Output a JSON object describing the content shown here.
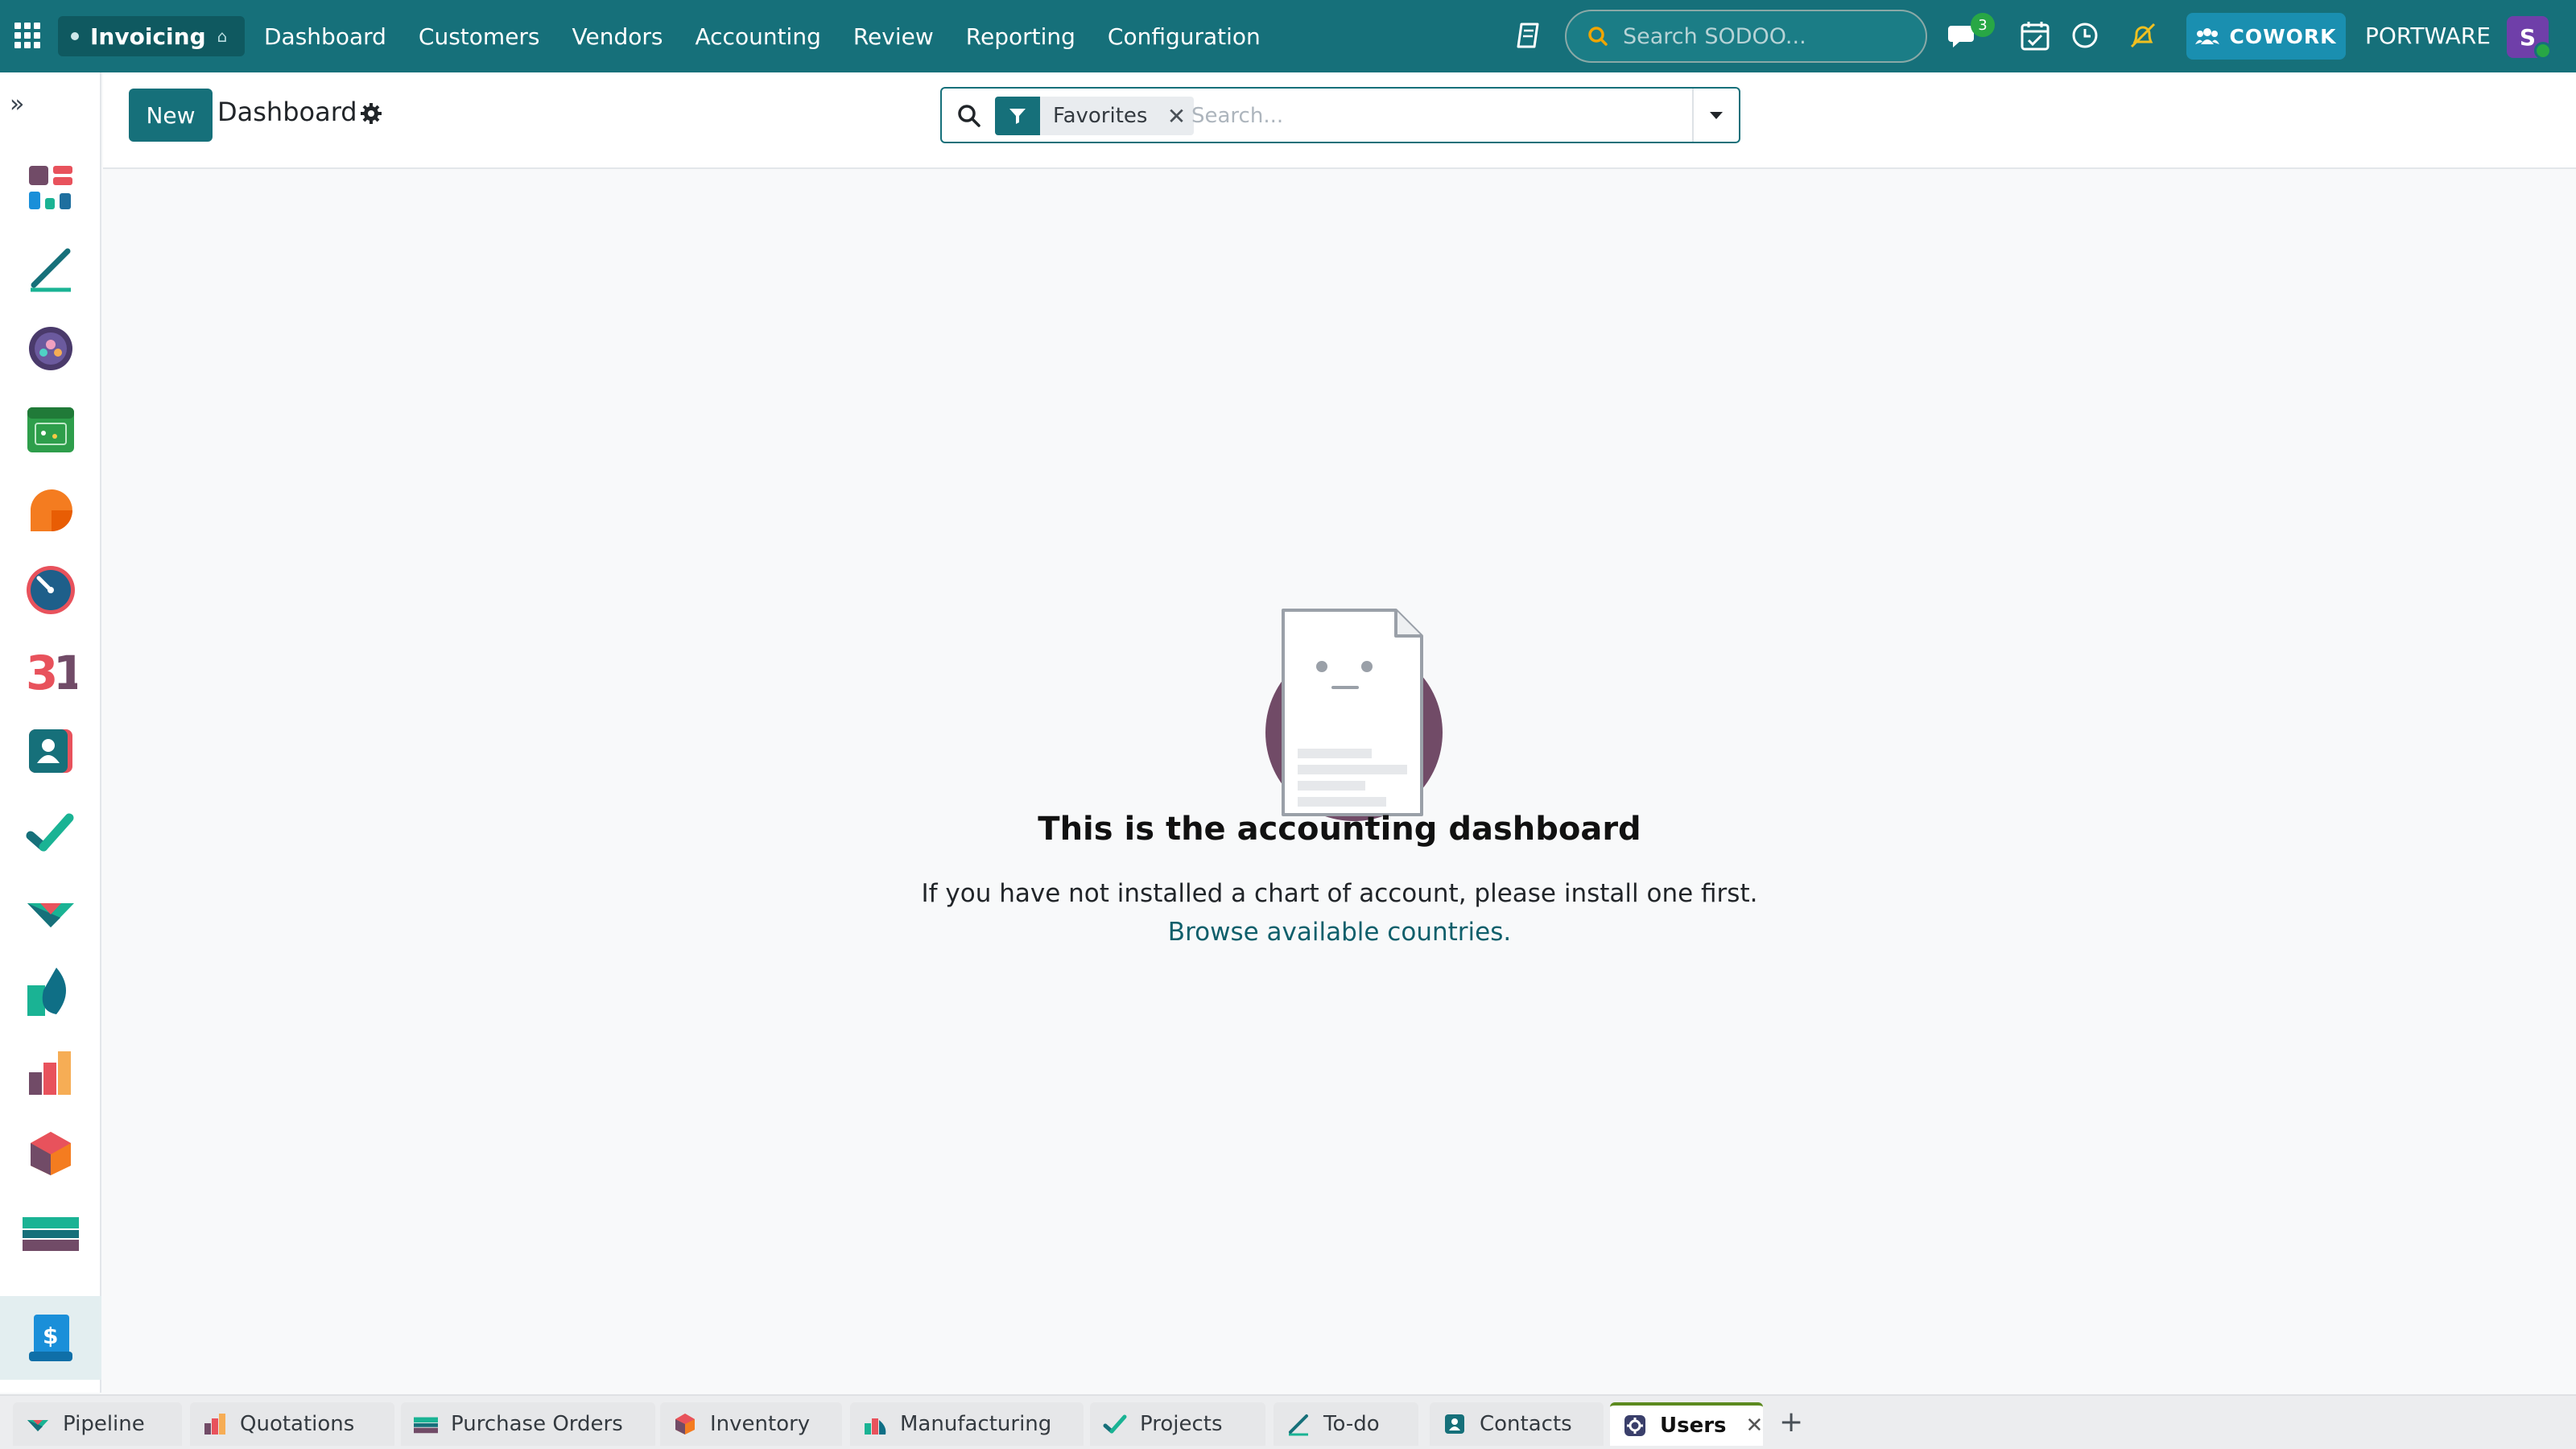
{
  "topbar": {
    "app_name": "Invoicing",
    "menu": [
      "Dashboard",
      "Customers",
      "Vendors",
      "Accounting",
      "Review",
      "Reporting",
      "Configuration"
    ],
    "search_placeholder": "Search SODOO...",
    "messages_count": "3",
    "cowork_label": "COWORK",
    "company": "PORTWARE",
    "avatar_initial": "S"
  },
  "sidebar": {
    "apps": [
      "dashboards-icon",
      "todo-icon",
      "discuss-icon",
      "calendar-icon",
      "helpdesk-icon",
      "timesheets-icon",
      "calendar-31-icon",
      "contacts-icon",
      "projects-icon",
      "crm-icon",
      "sale-icon",
      "purchase-icon",
      "inventory-icon",
      "manufacturing-icon",
      "invoicing-icon"
    ]
  },
  "control_panel": {
    "new_label": "New",
    "breadcrumb": "Dashboard",
    "facet_label": "Favorites",
    "search_placeholder": "Search..."
  },
  "empty_state": {
    "title": "This is the accounting dashboard",
    "description": "If you have not installed a chart of account, please install one first.",
    "link": "Browse available countries."
  },
  "bottom_tabs": [
    {
      "label": "Pipeline"
    },
    {
      "label": "Quotations"
    },
    {
      "label": "Purchase Orders"
    },
    {
      "label": "Inventory"
    },
    {
      "label": "Manufacturing"
    },
    {
      "label": "Projects"
    },
    {
      "label": "To-do"
    },
    {
      "label": "Contacts"
    },
    {
      "label": "Users",
      "active": true
    }
  ],
  "colors": {
    "brand": "#16707a",
    "brand_dark": "#0f5960",
    "badge_green": "#28a745",
    "cowork_blue": "#1a8fb0",
    "avatar_purple": "#6f3fa9",
    "link": "#0f5f6b",
    "illustration_circle": "#714b67"
  }
}
